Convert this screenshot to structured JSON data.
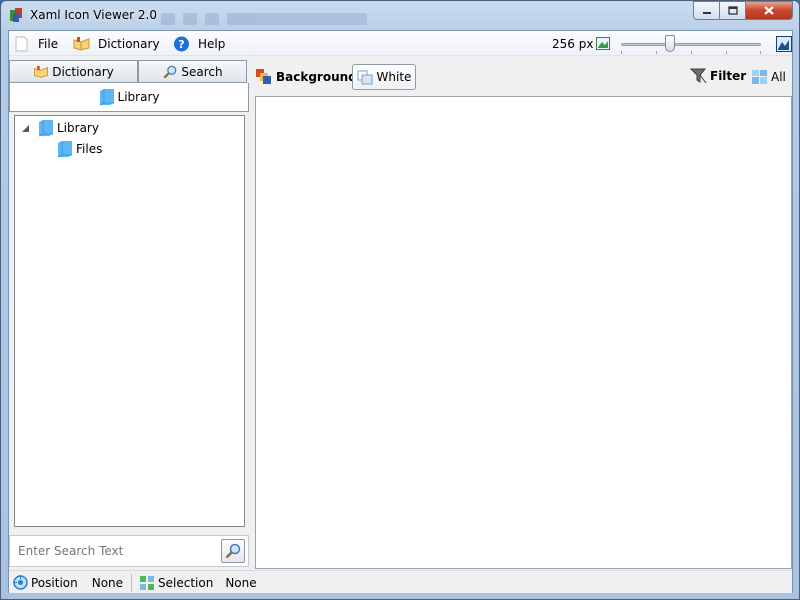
{
  "window": {
    "title": "Xaml Icon Viewer 2.0"
  },
  "menu": {
    "file": "File",
    "dictionary": "Dictionary",
    "help": "Help",
    "size_label": "256 px",
    "slider_position": 0.35
  },
  "left_tabs": {
    "dictionary": "Dictionary",
    "search": "Search"
  },
  "library_header": "Library",
  "tree": [
    {
      "label": "Library",
      "expanded": true
    },
    {
      "label": "Files"
    }
  ],
  "search": {
    "placeholder": "Enter Search Text",
    "value": ""
  },
  "toolbar": {
    "background_label": "Background",
    "white_label": "White",
    "filter_label": "Filter",
    "all_label": "All"
  },
  "status": {
    "position_label": "Position",
    "position_value": "None",
    "selection_label": "Selection",
    "selection_value": "None"
  },
  "colors": {
    "accent": "#3399ff",
    "library_blue": "#5bb8f5",
    "help_blue": "#1f6fd6"
  }
}
